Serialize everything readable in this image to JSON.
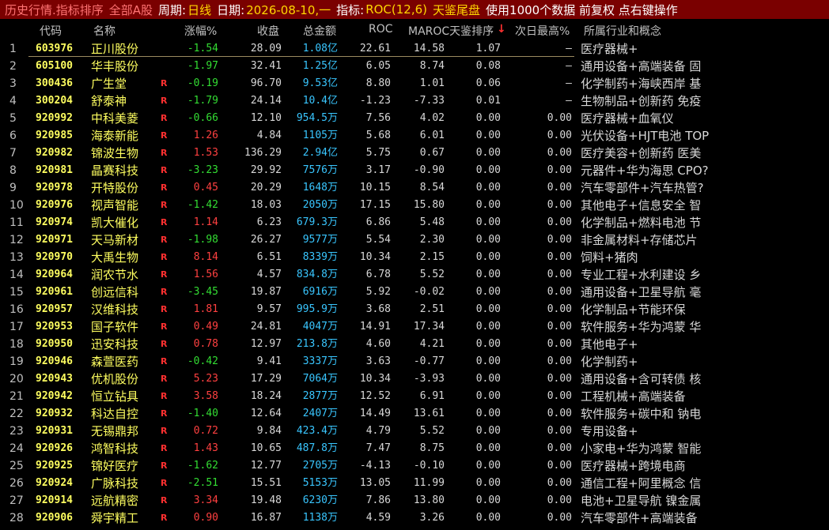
{
  "title": {
    "history": "历史行情.指标排序",
    "board": "全部A股",
    "period_label": "周期:",
    "period": "日线",
    "date_label": "日期:",
    "date": "2026-08-10,一",
    "indicator_label": "指标:",
    "indicator": "ROC(12,6)",
    "strategy": "天鉴尾盘",
    "info": "使用1000个数据 前复权 点右键操作"
  },
  "columns": {
    "code": "代码",
    "name": "名称",
    "pct": "涨幅%",
    "close": "收盘",
    "amount": "总金额",
    "roc": "ROC",
    "maroc": "MAROC天鉴排序",
    "sort_icon": "down-arrow",
    "next_high": "次日最高%",
    "industry": "所属行业和概念"
  },
  "colors": {
    "up": "#ff4040",
    "down": "#33dd33",
    "code": "#ffff60",
    "amount": "#39c6ff",
    "titlebar": "#7a0000"
  },
  "rows": [
    {
      "idx": "1",
      "code": "603976",
      "name": "正川股份",
      "flag": "",
      "pct": "-1.54",
      "close": "28.09",
      "amount": "1.08亿",
      "roc": "22.61",
      "maroc": "14.58",
      "rank": "1.07",
      "next_high": "–",
      "industry": "医疗器械+"
    },
    {
      "idx": "2",
      "code": "605100",
      "name": "华丰股份",
      "flag": "",
      "pct": "-1.97",
      "close": "32.41",
      "amount": "1.25亿",
      "roc": "6.05",
      "maroc": "8.74",
      "rank": "0.08",
      "next_high": "–",
      "industry": "通用设备+高端装备 固"
    },
    {
      "idx": "3",
      "code": "300436",
      "name": "广生堂",
      "flag": "R",
      "pct": "-0.19",
      "close": "96.70",
      "amount": "9.53亿",
      "roc": "8.80",
      "maroc": "1.01",
      "rank": "0.06",
      "next_high": "–",
      "industry": "化学制药+海峡西岸 基"
    },
    {
      "idx": "4",
      "code": "300204",
      "name": "舒泰神",
      "flag": "R",
      "pct": "-1.79",
      "close": "24.14",
      "amount": "10.4亿",
      "roc": "-1.23",
      "maroc": "-7.33",
      "rank": "0.01",
      "next_high": "–",
      "industry": "生物制品+创新药 免疫"
    },
    {
      "idx": "5",
      "code": "920992",
      "name": "中科美菱",
      "flag": "R",
      "pct": "-0.66",
      "close": "12.10",
      "amount": "954.5万",
      "roc": "7.56",
      "maroc": "4.02",
      "rank": "0.00",
      "next_high": "0.00",
      "industry": "医疗器械+血氧仪"
    },
    {
      "idx": "6",
      "code": "920985",
      "name": "海泰新能",
      "flag": "R",
      "pct": "1.26",
      "close": "4.84",
      "amount": "1105万",
      "roc": "5.68",
      "maroc": "6.01",
      "rank": "0.00",
      "next_high": "0.00",
      "industry": "光伏设备+HJT电池 TOP"
    },
    {
      "idx": "7",
      "code": "920982",
      "name": "锦波生物",
      "flag": "R",
      "pct": "1.53",
      "close": "136.29",
      "amount": "2.94亿",
      "roc": "5.75",
      "maroc": "0.67",
      "rank": "0.00",
      "next_high": "0.00",
      "industry": "医疗美容+创新药 医美"
    },
    {
      "idx": "8",
      "code": "920981",
      "name": "晶赛科技",
      "flag": "R",
      "pct": "-3.23",
      "close": "29.92",
      "amount": "7576万",
      "roc": "3.17",
      "maroc": "-0.90",
      "rank": "0.00",
      "next_high": "0.00",
      "industry": "元器件+华为海思 CPO?"
    },
    {
      "idx": "9",
      "code": "920978",
      "name": "开特股份",
      "flag": "R",
      "pct": "0.45",
      "close": "20.29",
      "amount": "1648万",
      "roc": "10.15",
      "maroc": "8.54",
      "rank": "0.00",
      "next_high": "0.00",
      "industry": "汽车零部件+汽车热管?"
    },
    {
      "idx": "10",
      "code": "920976",
      "name": "视声智能",
      "flag": "R",
      "pct": "-1.42",
      "close": "18.03",
      "amount": "2050万",
      "roc": "17.15",
      "maroc": "15.80",
      "rank": "0.00",
      "next_high": "0.00",
      "industry": "其他电子+信息安全 智"
    },
    {
      "idx": "11",
      "code": "920974",
      "name": "凯大催化",
      "flag": "R",
      "pct": "1.14",
      "close": "6.23",
      "amount": "679.3万",
      "roc": "6.86",
      "maroc": "5.48",
      "rank": "0.00",
      "next_high": "0.00",
      "industry": "化学制品+燃料电池 节"
    },
    {
      "idx": "12",
      "code": "920971",
      "name": "天马新材",
      "flag": "R",
      "pct": "-1.98",
      "close": "26.27",
      "amount": "9577万",
      "roc": "5.54",
      "maroc": "2.30",
      "rank": "0.00",
      "next_high": "0.00",
      "industry": "非金属材料+存储芯片"
    },
    {
      "idx": "13",
      "code": "920970",
      "name": "大禹生物",
      "flag": "R",
      "pct": "8.14",
      "close": "6.51",
      "amount": "8339万",
      "roc": "10.34",
      "maroc": "2.15",
      "rank": "0.00",
      "next_high": "0.00",
      "industry": "饲料+猪肉"
    },
    {
      "idx": "14",
      "code": "920964",
      "name": "润农节水",
      "flag": "R",
      "pct": "1.56",
      "close": "4.57",
      "amount": "834.8万",
      "roc": "6.78",
      "maroc": "5.52",
      "rank": "0.00",
      "next_high": "0.00",
      "industry": "专业工程+水利建设 乡"
    },
    {
      "idx": "15",
      "code": "920961",
      "name": "创远信科",
      "flag": "R",
      "pct": "-3.45",
      "close": "19.87",
      "amount": "6916万",
      "roc": "5.92",
      "maroc": "-0.02",
      "rank": "0.00",
      "next_high": "0.00",
      "industry": "通用设备+卫星导航 毫"
    },
    {
      "idx": "16",
      "code": "920957",
      "name": "汉维科技",
      "flag": "R",
      "pct": "1.81",
      "close": "9.57",
      "amount": "995.9万",
      "roc": "3.68",
      "maroc": "2.51",
      "rank": "0.00",
      "next_high": "0.00",
      "industry": "化学制品+节能环保"
    },
    {
      "idx": "17",
      "code": "920953",
      "name": "国子软件",
      "flag": "R",
      "pct": "0.49",
      "close": "24.81",
      "amount": "4047万",
      "roc": "14.91",
      "maroc": "17.34",
      "rank": "0.00",
      "next_high": "0.00",
      "industry": "软件服务+华为鸿蒙 华"
    },
    {
      "idx": "18",
      "code": "920950",
      "name": "迅安科技",
      "flag": "R",
      "pct": "0.78",
      "close": "12.97",
      "amount": "213.8万",
      "roc": "4.60",
      "maroc": "4.21",
      "rank": "0.00",
      "next_high": "0.00",
      "industry": "其他电子+"
    },
    {
      "idx": "19",
      "code": "920946",
      "name": "森萱医药",
      "flag": "R",
      "pct": "-0.42",
      "close": "9.41",
      "amount": "3337万",
      "roc": "3.63",
      "maroc": "-0.77",
      "rank": "0.00",
      "next_high": "0.00",
      "industry": "化学制药+"
    },
    {
      "idx": "20",
      "code": "920943",
      "name": "优机股份",
      "flag": "R",
      "pct": "5.23",
      "close": "17.29",
      "amount": "7064万",
      "roc": "10.34",
      "maroc": "-3.93",
      "rank": "0.00",
      "next_high": "0.00",
      "industry": "通用设备+含可转债 核"
    },
    {
      "idx": "21",
      "code": "920942",
      "name": "恒立钻具",
      "flag": "R",
      "pct": "3.58",
      "close": "18.24",
      "amount": "2877万",
      "roc": "12.52",
      "maroc": "6.91",
      "rank": "0.00",
      "next_high": "0.00",
      "industry": "工程机械+高端装备"
    },
    {
      "idx": "22",
      "code": "920932",
      "name": "科达自控",
      "flag": "R",
      "pct": "-1.40",
      "close": "12.64",
      "amount": "2407万",
      "roc": "14.49",
      "maroc": "13.61",
      "rank": "0.00",
      "next_high": "0.00",
      "industry": "软件服务+碳中和 钠电"
    },
    {
      "idx": "23",
      "code": "920931",
      "name": "无锡鼎邦",
      "flag": "R",
      "pct": "0.72",
      "close": "9.84",
      "amount": "423.4万",
      "roc": "4.79",
      "maroc": "5.52",
      "rank": "0.00",
      "next_high": "0.00",
      "industry": "专用设备+"
    },
    {
      "idx": "24",
      "code": "920926",
      "name": "鸿智科技",
      "flag": "R",
      "pct": "1.43",
      "close": "10.65",
      "amount": "487.8万",
      "roc": "7.47",
      "maroc": "8.75",
      "rank": "0.00",
      "next_high": "0.00",
      "industry": "小家电+华为鸿蒙 智能"
    },
    {
      "idx": "25",
      "code": "920925",
      "name": "锦好医疗",
      "flag": "R",
      "pct": "-1.62",
      "close": "12.77",
      "amount": "2705万",
      "roc": "-4.13",
      "maroc": "-0.10",
      "rank": "0.00",
      "next_high": "0.00",
      "industry": "医疗器械+跨境电商"
    },
    {
      "idx": "26",
      "code": "920924",
      "name": "广脉科技",
      "flag": "R",
      "pct": "-2.51",
      "close": "15.51",
      "amount": "5153万",
      "roc": "13.05",
      "maroc": "11.99",
      "rank": "0.00",
      "next_high": "0.00",
      "industry": "通信工程+阿里概念 信"
    },
    {
      "idx": "27",
      "code": "920914",
      "name": "远航精密",
      "flag": "R",
      "pct": "3.34",
      "close": "19.48",
      "amount": "6230万",
      "roc": "7.86",
      "maroc": "13.80",
      "rank": "0.00",
      "next_high": "0.00",
      "industry": "电池+卫星导航 镍金属"
    },
    {
      "idx": "28",
      "code": "920906",
      "name": "舜宇精工",
      "flag": "R",
      "pct": "0.90",
      "close": "16.87",
      "amount": "1138万",
      "roc": "4.59",
      "maroc": "3.26",
      "rank": "0.00",
      "next_high": "0.00",
      "industry": "汽车零部件+高端装备"
    }
  ]
}
